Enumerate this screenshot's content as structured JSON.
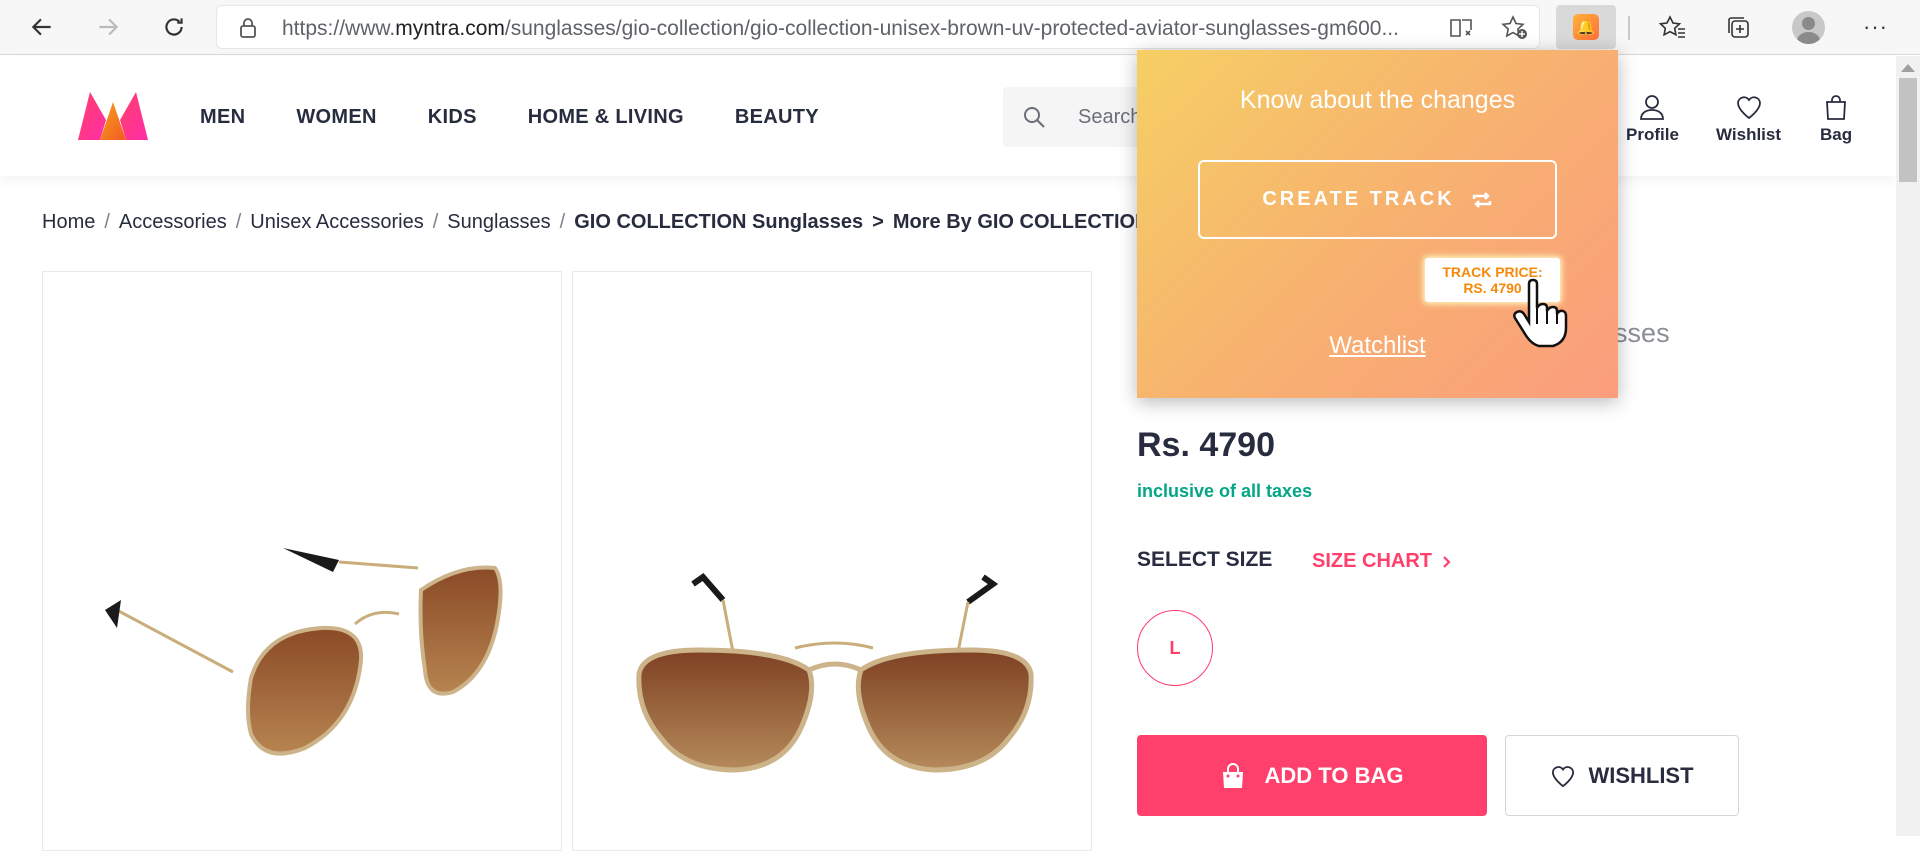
{
  "browser": {
    "url_prefix": "https://www.",
    "url_domain": "myntra.com",
    "url_path": "/sunglasses/gio-collection/gio-collection-unisex-brown-uv-protected-aviator-sunglasses-gm600..."
  },
  "header": {
    "nav": [
      "MEN",
      "WOMEN",
      "KIDS",
      "HOME & LIVING",
      "BEAUTY"
    ],
    "search_placeholder": "Search",
    "actions": {
      "profile": "Profile",
      "wishlist": "Wishlist",
      "bag": "Bag"
    }
  },
  "breadcrumb": {
    "items": [
      "Home",
      "Accessories",
      "Unisex Accessories",
      "Sunglasses",
      "GIO COLLECTION Sunglasses"
    ],
    "last": "More By GIO COLLECTION"
  },
  "product": {
    "title_fragment": "nglasses",
    "price": "Rs. 4790",
    "tax_note": "inclusive of all taxes",
    "select_size": "SELECT SIZE",
    "size_chart": "SIZE CHART",
    "sizes": [
      "L"
    ],
    "add_to_bag": "ADD TO BAG",
    "wishlist": "WISHLIST"
  },
  "popup": {
    "title": "Know about the changes",
    "create_track": "CREATE TRACK",
    "tip_line1": "TRACK PRICE:",
    "tip_line2": "RS. 4790",
    "watchlist": "Watchlist"
  },
  "colors": {
    "brand_pink": "#ff3f6c",
    "tax_green": "#03a685",
    "popup_gradient_start": "#f6cf64",
    "popup_gradient_end": "#fb9d7d"
  }
}
